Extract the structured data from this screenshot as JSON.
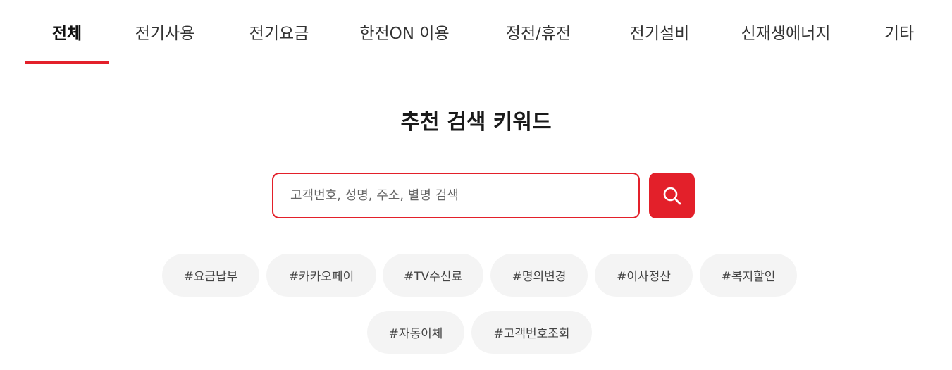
{
  "tabs": [
    {
      "label": "전체",
      "active": true
    },
    {
      "label": "전기사용",
      "active": false
    },
    {
      "label": "전기요금",
      "active": false
    },
    {
      "label": "한전ON 이용",
      "active": false
    },
    {
      "label": "정전/휴전",
      "active": false
    },
    {
      "label": "전기설비",
      "active": false
    },
    {
      "label": "신재생에너지",
      "active": false
    },
    {
      "label": "기타",
      "active": false
    }
  ],
  "section": {
    "title": "추천 검색 키워드"
  },
  "search": {
    "placeholder": "고객번호, 성명, 주소, 별명 검색",
    "value": "",
    "button_icon": "search-icon"
  },
  "keywords": [
    "#요금납부",
    "#카카오페이",
    "#TV수신료",
    "#명의변경",
    "#이사정산",
    "#복지할인",
    "#자동이체",
    "#고객번호조회"
  ],
  "colors": {
    "accent": "#e3202a",
    "chip_bg": "#f4f4f4"
  }
}
